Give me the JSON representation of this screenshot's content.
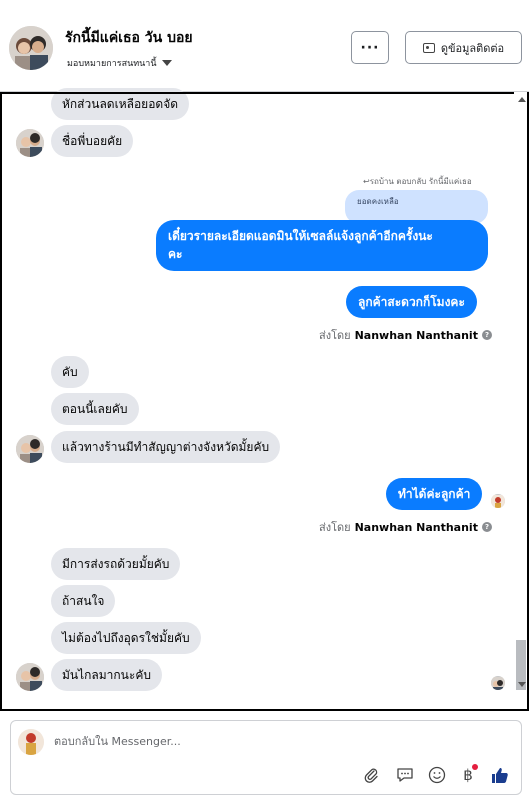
{
  "header": {
    "contact_name": "รักนี้มีแค่เธอ วัน บอย",
    "assign_label": "มอบหมายการสนทนานี้",
    "more_label": "···",
    "contact_info_label": "ดูข้อมูลติดต่อ"
  },
  "messages": {
    "m1": "หักส่วนลดเหลือยอดจัด",
    "m2": "ชื่อพี่บอยคัย",
    "reply_label": "รถบ้าน ตอบกลับ รักนี้มีแค่เธอ",
    "quoted": "ยอดคงเหลือ",
    "m3_line1": "เดี๋ยวรายละเอียดแอดมินให้เซลล์แจ้งลูกค้าอีกครั้งนะ",
    "m3_line2": "คะ",
    "m4": "ลูกค้าสะดวกก็โมงคะ",
    "sent_by_prefix": "ส่งโดย",
    "sent_by_name": "Nanwhan Nanthanit",
    "m5": "คับ",
    "m6": "ตอนนี้เลยคับ",
    "m7": "แล้วทางร้านมีทำสัญญาต่างจังหวัดมั้ยคับ",
    "m8": "ทำได้ค่ะลูกค้า",
    "m9": "มีการส่งรถด้วยมั้ยคับ",
    "m10": "ถ้าสนใจ",
    "m11": "ไม่ต้องไปถึงอุดรใช่มั้ยคับ",
    "m12": "มันไกลมากนะคับ"
  },
  "composer": {
    "placeholder": "ตอบกลับใน Messenger...",
    "currency_symbol": "฿"
  },
  "colors": {
    "outgoing_bubble": "#0a7cff",
    "incoming_bubble": "#e4e6eb",
    "like_icon": "#1a3d8f"
  },
  "icons": [
    "more-icon",
    "contact-card-icon",
    "caret-down-icon",
    "help-icon",
    "attach-icon",
    "chat-icon",
    "emoji-icon",
    "baht-icon",
    "like-icon"
  ]
}
